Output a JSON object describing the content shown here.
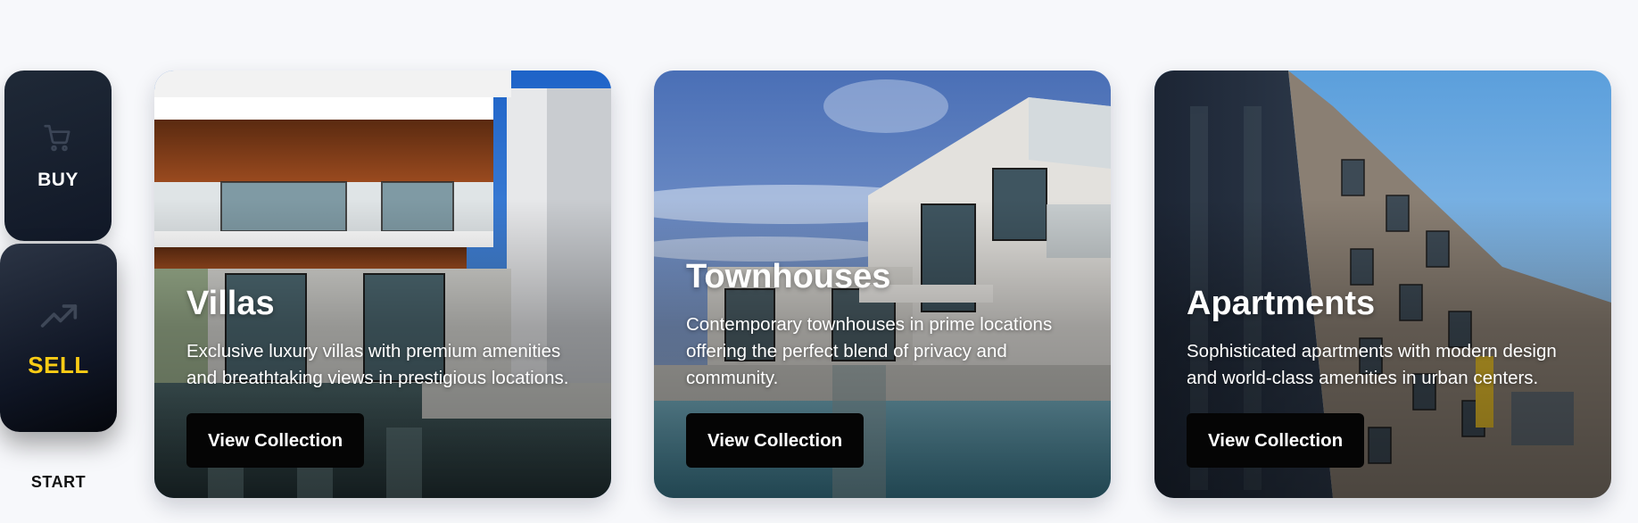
{
  "nav": {
    "buy": {
      "label": "BUY",
      "icon": "shopping-cart-icon"
    },
    "sell": {
      "label": "SELL",
      "icon": "trending-up-icon",
      "accent": "#facc15"
    },
    "start": {
      "label": "START"
    }
  },
  "cards": [
    {
      "title": "Villas",
      "description": "Exclusive luxury villas with premium amenities and breathtaking views in prestigious locations.",
      "button": "View Collection"
    },
    {
      "title": "Townhouses",
      "description": "Contemporary townhouses in prime locations offering the perfect blend of privacy and community.",
      "button": "View Collection"
    },
    {
      "title": "Apartments",
      "description": "Sophisticated apartments with modern design and world-class amenities in urban centers.",
      "button": "View Collection"
    }
  ],
  "colors": {
    "background": "#f7f8fb",
    "nav_dark": "#111827",
    "button": "#050505"
  }
}
